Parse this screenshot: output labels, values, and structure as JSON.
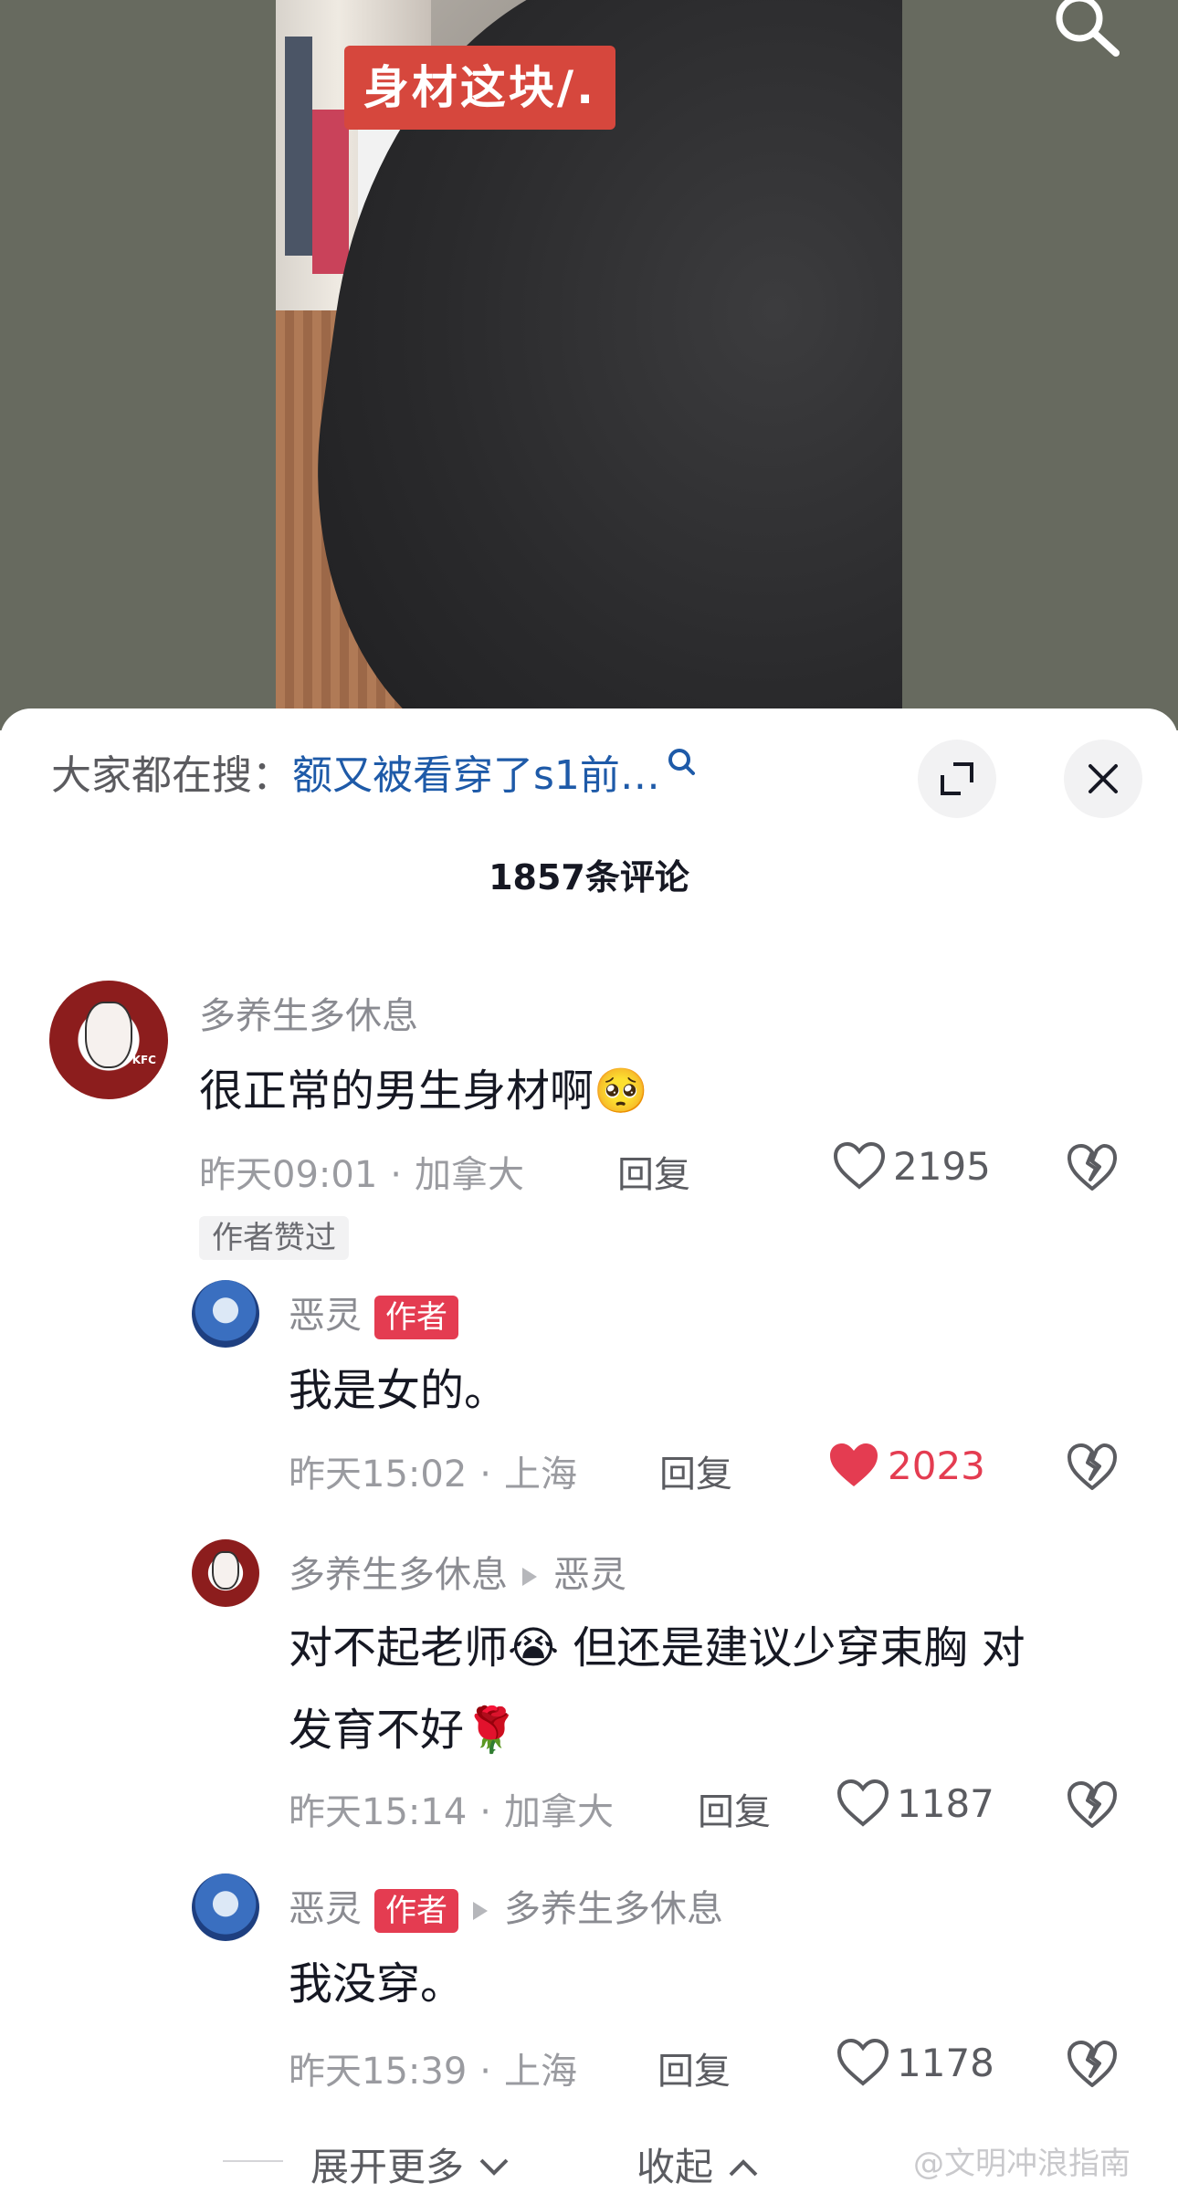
{
  "video": {
    "caption": "身材这块/."
  },
  "comments_sheet": {
    "search_prefix": "大家都在搜：",
    "search_query": "额又被看穿了s1前…",
    "comment_count": "1857条评论"
  },
  "comments": [
    {
      "user": "多养生多休息",
      "text": "很正常的男生身材啊🥺",
      "time": "昨天09:01",
      "location": "加拿大",
      "reply_label": "回复",
      "likes": "2195",
      "author_liked_tag": "作者赞过"
    },
    {
      "user": "恶灵",
      "author_badge": "作者",
      "text": "我是女的。",
      "time": "昨天15:02",
      "location": "上海",
      "reply_label": "回复",
      "likes": "2023"
    },
    {
      "user": "多养生多休息",
      "reply_to": "恶灵",
      "text_line1": "对不起老师😭 但还是建议少穿束胸 对",
      "text_line2": "发育不好🌹",
      "time": "昨天15:14",
      "location": "加拿大",
      "reply_label": "回复",
      "likes": "1187"
    },
    {
      "user": "恶灵",
      "author_badge": "作者",
      "reply_to": "多养生多休息",
      "text": "我没穿。",
      "time": "昨天15:39",
      "location": "上海",
      "reply_label": "回复",
      "likes": "1178"
    }
  ],
  "footer": {
    "expand_more": "展开更多",
    "collapse": "收起",
    "watermark": "@文明冲浪指南"
  },
  "colors": {
    "accent_red": "#e43c51",
    "link_blue": "#1e5aa8",
    "video_bg": "#676a5f"
  }
}
